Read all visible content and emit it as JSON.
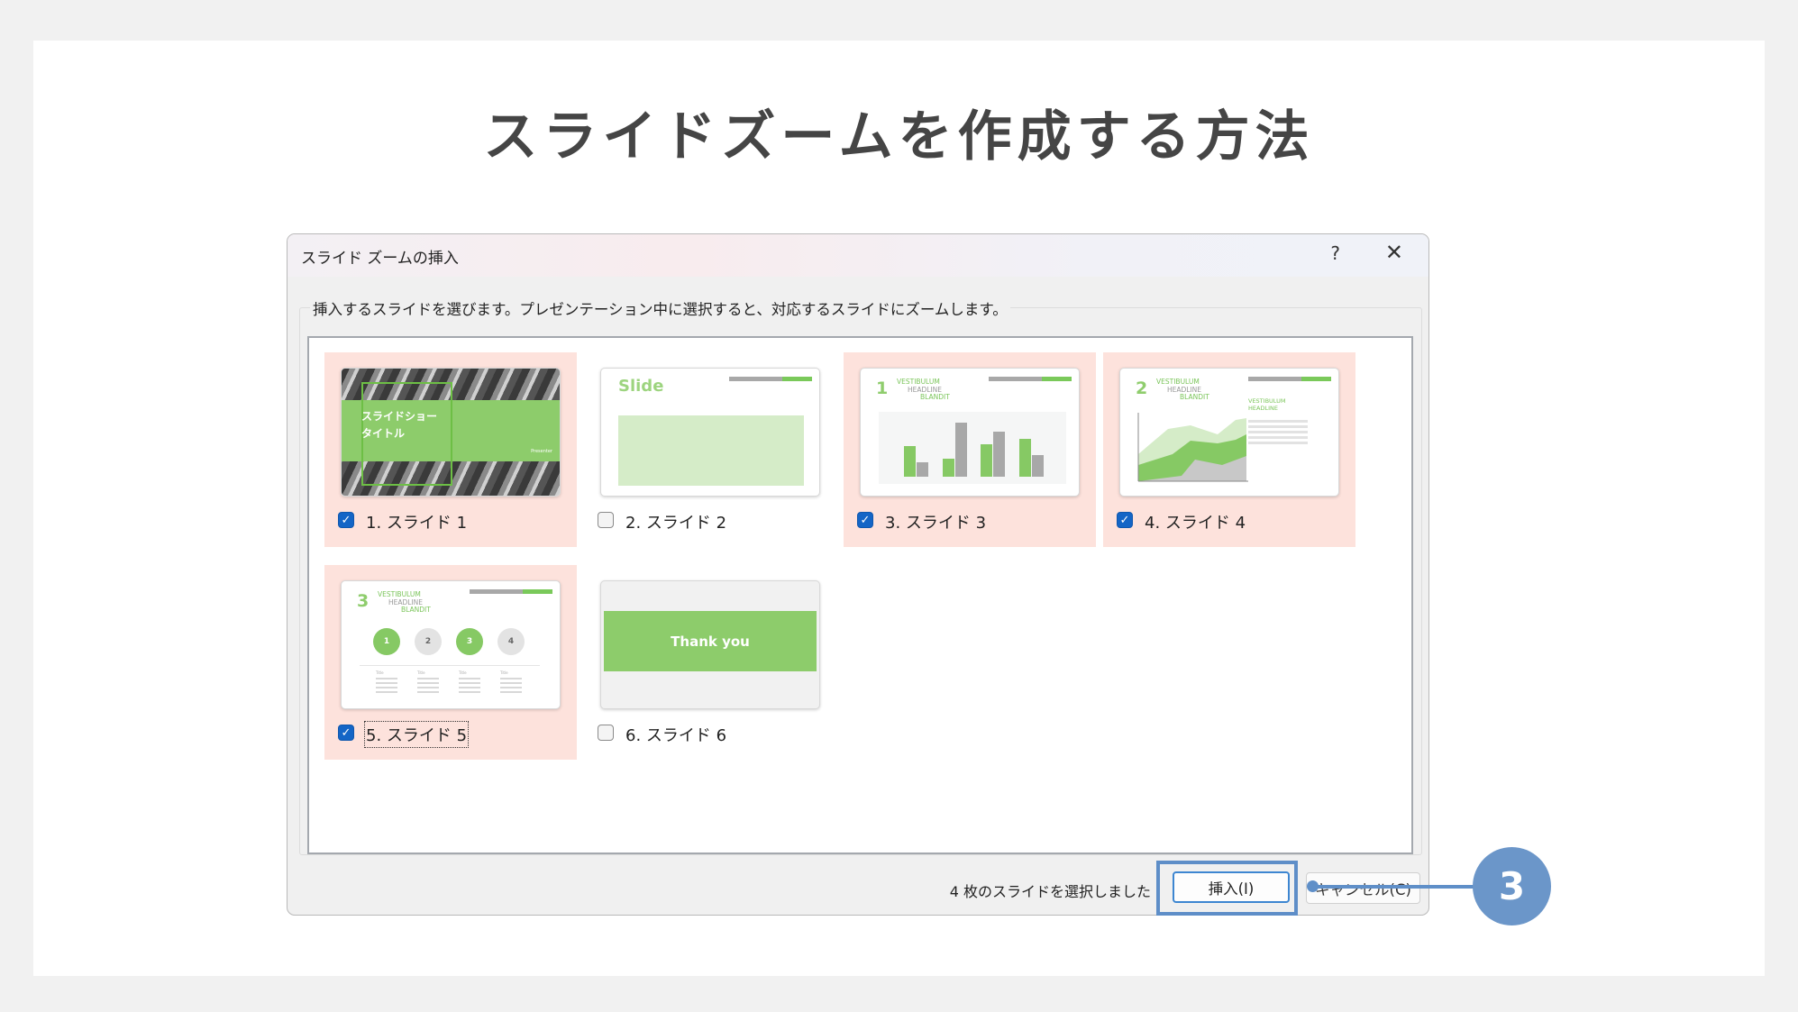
{
  "page": {
    "title": "スライドズームを作成する方法"
  },
  "dialog": {
    "title": "スライド ズームの挿入",
    "help_label": "?",
    "close_label": "✕",
    "instruction": "挿入するスライドを選びます。プレゼンテーション中に選択すると、対応するスライドにズームします。",
    "status_text": "4 枚のスライドを選択しました",
    "insert_label": "挿入(I)",
    "cancel_label": "キャンセル(C)"
  },
  "slides": [
    {
      "label": "1. スライド 1",
      "checked": true,
      "thumb_text_line1": "スライドショー",
      "thumb_text_line2": "タイトル",
      "thumb_small": "Presenter"
    },
    {
      "label": "2. スライド 2",
      "checked": false,
      "thumb_text": "Slide"
    },
    {
      "label": "3. スライド 3",
      "checked": true,
      "num": "1",
      "line1": "VESTIBULUM",
      "line2": "HEADLINE",
      "line3": "BLANDIT"
    },
    {
      "label": "4. スライド 4",
      "checked": true,
      "num": "2",
      "line1": "VESTIBULUM",
      "line2": "HEADLINE",
      "line3": "BLANDIT",
      "side1": "VESTIBULUM",
      "side2": "HEADLINE"
    },
    {
      "label": "5. スライド 5",
      "checked": true,
      "focused": true,
      "num": "3",
      "line1": "VESTIBULUM",
      "line2": "HEADLINE",
      "line3": "BLANDIT",
      "circles": [
        "1",
        "2",
        "3",
        "4"
      ],
      "col_title": "Title"
    },
    {
      "label": "6. スライド 6",
      "checked": false,
      "thumb_text": "Thank you"
    }
  ],
  "checkmark": "✓",
  "callout": {
    "number": "3",
    "color": "#6b96c9"
  },
  "colors": {
    "selected_bg": "#fde2dc",
    "accent_green": "#8dcc6b",
    "checkbox_blue": "#1465c6"
  }
}
